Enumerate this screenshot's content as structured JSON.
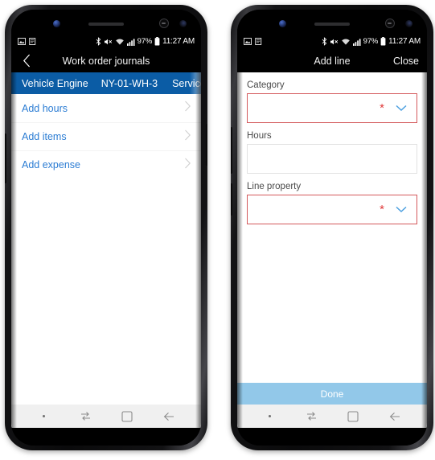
{
  "phones": [
    {
      "id": "work-order-journals",
      "statusbar": {
        "icons_left": [
          "image-icon",
          "document-icon"
        ],
        "icons_right": [
          "bluetooth-icon",
          "mute-icon",
          "wifi-icon",
          "signal-icon"
        ],
        "battery_percent": "97%",
        "battery_icon": "battery-icon",
        "time": "11:27 AM"
      },
      "navbar": {
        "back_icon": "back-chevron-icon",
        "title": "Work order journals"
      },
      "context_bar": {
        "background": "#0b5ca5",
        "items": [
          "Vehicle Engine",
          "NY-01-WH-3",
          "Service"
        ]
      },
      "list": [
        {
          "label": "Add hours",
          "chevron": "chevron-right-icon"
        },
        {
          "label": "Add items",
          "chevron": "chevron-right-icon"
        },
        {
          "label": "Add expense",
          "chevron": "chevron-right-icon"
        }
      ],
      "softnav": [
        "dot-indicator",
        "recents-icon",
        "home-icon",
        "back-arrow-icon"
      ]
    },
    {
      "id": "add-line",
      "statusbar": {
        "icons_left": [
          "image-icon",
          "document-icon"
        ],
        "icons_right": [
          "bluetooth-icon",
          "mute-icon",
          "wifi-icon",
          "signal-icon"
        ],
        "battery_percent": "97%",
        "battery_icon": "battery-icon",
        "time": "11:27 AM"
      },
      "navbar": {
        "title": "Add line",
        "action_label": "Close"
      },
      "fields": [
        {
          "label": "Category",
          "value": "",
          "required": true,
          "required_marker": "*",
          "control": "dropdown",
          "chevron": "chevron-down-icon",
          "border_color": "#d4595c"
        },
        {
          "label": "Hours",
          "value": "",
          "required": false,
          "control": "text",
          "border_color": "#e2e2e2"
        },
        {
          "label": "Line property",
          "value": "",
          "required": true,
          "required_marker": "*",
          "control": "dropdown",
          "chevron": "chevron-down-icon",
          "border_color": "#d4595c"
        }
      ],
      "done_button": {
        "label": "Done",
        "background": "#92c8e9"
      },
      "softnav": [
        "dot-indicator",
        "recents-icon",
        "home-icon",
        "back-arrow-icon"
      ]
    }
  ],
  "colors": {
    "accent_blue": "#0b5ca5",
    "link_blue": "#2b7cd3",
    "required_red": "#d4595c",
    "star_red": "#e03b3b",
    "done_blue": "#92c8e9",
    "chevron_blue": "#4a9fe0"
  }
}
